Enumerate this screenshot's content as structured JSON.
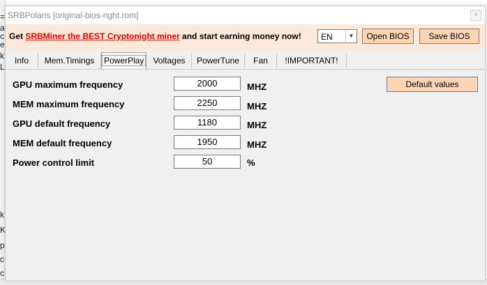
{
  "window": {
    "title": "SRBPolaris [original-bios-right.rom]",
    "close_glyph": "×"
  },
  "background": {
    "side_chars": [
      "=",
      "a",
      "c",
      "e",
      "k",
      "Li",
      "k",
      "K",
      "p",
      "c",
      "c"
    ]
  },
  "banner": {
    "promo_prefix": "Get ",
    "promo_link": "SRBMiner the BEST Cryptonight miner",
    "promo_suffix": " and start earning money now!",
    "language": "EN",
    "open_bios_label": "Open BIOS",
    "save_bios_label": "Save BIOS"
  },
  "tabs": [
    {
      "label": "Info",
      "active": false
    },
    {
      "label": "Mem.Timings",
      "active": false
    },
    {
      "label": "PowerPlay",
      "active": true
    },
    {
      "label": "Voltages",
      "active": false
    },
    {
      "label": "PowerTune",
      "active": false
    },
    {
      "label": "Fan",
      "active": false
    },
    {
      "label": "!IMPORTANT!",
      "active": false
    }
  ],
  "powerplay": {
    "default_values_label": "Default values",
    "rows": [
      {
        "label": "GPU maximum frequency",
        "value": "2000",
        "unit": "MHZ"
      },
      {
        "label": "MEM maximum frequency",
        "value": "2250",
        "unit": "MHZ"
      },
      {
        "label": "GPU default frequency",
        "value": "1180",
        "unit": "MHZ"
      },
      {
        "label": "MEM default frequency",
        "value": "1950",
        "unit": "MHZ"
      },
      {
        "label": "Power control limit",
        "value": "50",
        "unit": "%"
      }
    ]
  },
  "colors": {
    "banner_bg": "#fde9d9",
    "button_bg": "#fdd4b4",
    "link": "#e00000"
  }
}
